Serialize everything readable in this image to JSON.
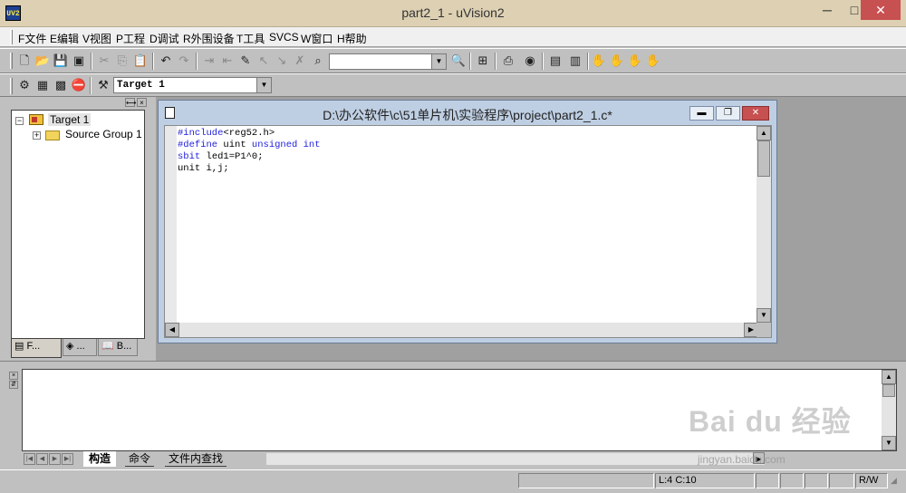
{
  "window": {
    "title": "part2_1  - uVision2",
    "icon": "uv2-app-icon"
  },
  "window_controls": {
    "minimize": "─",
    "maximize": "□",
    "close": "✕"
  },
  "menu": [
    {
      "label": "F文件"
    },
    {
      "label": "E编辑"
    },
    {
      "label": "V视图"
    },
    {
      "label": "P工程"
    },
    {
      "label": "D调试"
    },
    {
      "label": "R外围设备"
    },
    {
      "label": "T工具"
    },
    {
      "label": "SVCS"
    },
    {
      "label": "W窗口"
    },
    {
      "label": "H帮助"
    }
  ],
  "toolbar": {
    "find_value": "",
    "target_value": "Target 1"
  },
  "project": {
    "tree": [
      {
        "label": "Target 1",
        "expander": "−"
      },
      {
        "label": "Source Group 1",
        "expander": "+"
      }
    ],
    "tabs": [
      {
        "label": "F..."
      },
      {
        "label": "..."
      },
      {
        "label": "B..."
      }
    ],
    "close_glyph": "×"
  },
  "editor": {
    "title": "D:\\办公软件\\c\\51单片机\\实验程序\\project\\part2_1.c*",
    "lines": [
      {
        "kw": "#include",
        "rest": "<reg52.h>"
      },
      {
        "kw": "#define",
        "rest": " uint ",
        "kw2": "unsigned int"
      },
      {
        "kw": "sbit",
        "rest": " led1=P1^0;"
      },
      {
        "kw": "",
        "rest": "unit i,j;"
      }
    ]
  },
  "output": {
    "tabs": [
      {
        "label": "构造"
      },
      {
        "label": "命令"
      },
      {
        "label": "文件内查找"
      }
    ]
  },
  "status": {
    "position": "L:4 C:10",
    "mode": "R/W"
  },
  "watermark": {
    "main": "Bai du 经验",
    "sub": "jingyan.baidu.com"
  }
}
